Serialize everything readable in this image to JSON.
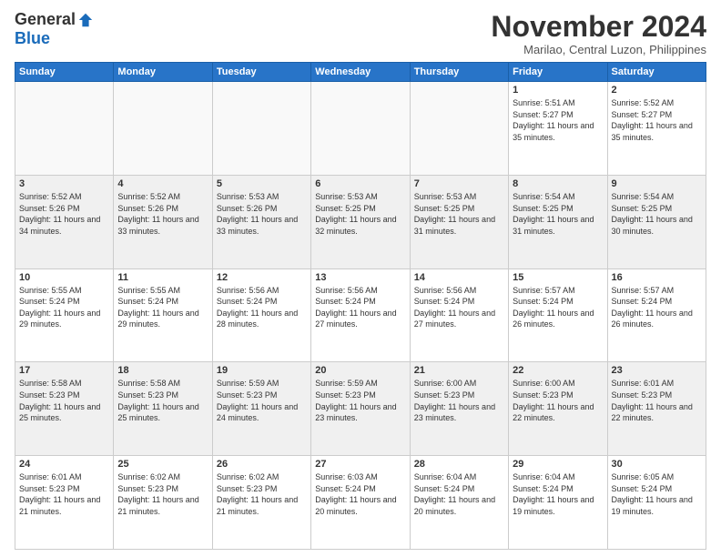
{
  "logo": {
    "general": "General",
    "blue": "Blue"
  },
  "title": "November 2024",
  "location": "Marilao, Central Luzon, Philippines",
  "weekdays": [
    "Sunday",
    "Monday",
    "Tuesday",
    "Wednesday",
    "Thursday",
    "Friday",
    "Saturday"
  ],
  "weeks": [
    [
      {
        "day": "",
        "sunrise": "",
        "sunset": "",
        "daylight": ""
      },
      {
        "day": "",
        "sunrise": "",
        "sunset": "",
        "daylight": ""
      },
      {
        "day": "",
        "sunrise": "",
        "sunset": "",
        "daylight": ""
      },
      {
        "day": "",
        "sunrise": "",
        "sunset": "",
        "daylight": ""
      },
      {
        "day": "",
        "sunrise": "",
        "sunset": "",
        "daylight": ""
      },
      {
        "day": "1",
        "sunrise": "Sunrise: 5:51 AM",
        "sunset": "Sunset: 5:27 PM",
        "daylight": "Daylight: 11 hours and 35 minutes."
      },
      {
        "day": "2",
        "sunrise": "Sunrise: 5:52 AM",
        "sunset": "Sunset: 5:27 PM",
        "daylight": "Daylight: 11 hours and 35 minutes."
      }
    ],
    [
      {
        "day": "3",
        "sunrise": "Sunrise: 5:52 AM",
        "sunset": "Sunset: 5:26 PM",
        "daylight": "Daylight: 11 hours and 34 minutes."
      },
      {
        "day": "4",
        "sunrise": "Sunrise: 5:52 AM",
        "sunset": "Sunset: 5:26 PM",
        "daylight": "Daylight: 11 hours and 33 minutes."
      },
      {
        "day": "5",
        "sunrise": "Sunrise: 5:53 AM",
        "sunset": "Sunset: 5:26 PM",
        "daylight": "Daylight: 11 hours and 33 minutes."
      },
      {
        "day": "6",
        "sunrise": "Sunrise: 5:53 AM",
        "sunset": "Sunset: 5:25 PM",
        "daylight": "Daylight: 11 hours and 32 minutes."
      },
      {
        "day": "7",
        "sunrise": "Sunrise: 5:53 AM",
        "sunset": "Sunset: 5:25 PM",
        "daylight": "Daylight: 11 hours and 31 minutes."
      },
      {
        "day": "8",
        "sunrise": "Sunrise: 5:54 AM",
        "sunset": "Sunset: 5:25 PM",
        "daylight": "Daylight: 11 hours and 31 minutes."
      },
      {
        "day": "9",
        "sunrise": "Sunrise: 5:54 AM",
        "sunset": "Sunset: 5:25 PM",
        "daylight": "Daylight: 11 hours and 30 minutes."
      }
    ],
    [
      {
        "day": "10",
        "sunrise": "Sunrise: 5:55 AM",
        "sunset": "Sunset: 5:24 PM",
        "daylight": "Daylight: 11 hours and 29 minutes."
      },
      {
        "day": "11",
        "sunrise": "Sunrise: 5:55 AM",
        "sunset": "Sunset: 5:24 PM",
        "daylight": "Daylight: 11 hours and 29 minutes."
      },
      {
        "day": "12",
        "sunrise": "Sunrise: 5:56 AM",
        "sunset": "Sunset: 5:24 PM",
        "daylight": "Daylight: 11 hours and 28 minutes."
      },
      {
        "day": "13",
        "sunrise": "Sunrise: 5:56 AM",
        "sunset": "Sunset: 5:24 PM",
        "daylight": "Daylight: 11 hours and 27 minutes."
      },
      {
        "day": "14",
        "sunrise": "Sunrise: 5:56 AM",
        "sunset": "Sunset: 5:24 PM",
        "daylight": "Daylight: 11 hours and 27 minutes."
      },
      {
        "day": "15",
        "sunrise": "Sunrise: 5:57 AM",
        "sunset": "Sunset: 5:24 PM",
        "daylight": "Daylight: 11 hours and 26 minutes."
      },
      {
        "day": "16",
        "sunrise": "Sunrise: 5:57 AM",
        "sunset": "Sunset: 5:24 PM",
        "daylight": "Daylight: 11 hours and 26 minutes."
      }
    ],
    [
      {
        "day": "17",
        "sunrise": "Sunrise: 5:58 AM",
        "sunset": "Sunset: 5:23 PM",
        "daylight": "Daylight: 11 hours and 25 minutes."
      },
      {
        "day": "18",
        "sunrise": "Sunrise: 5:58 AM",
        "sunset": "Sunset: 5:23 PM",
        "daylight": "Daylight: 11 hours and 25 minutes."
      },
      {
        "day": "19",
        "sunrise": "Sunrise: 5:59 AM",
        "sunset": "Sunset: 5:23 PM",
        "daylight": "Daylight: 11 hours and 24 minutes."
      },
      {
        "day": "20",
        "sunrise": "Sunrise: 5:59 AM",
        "sunset": "Sunset: 5:23 PM",
        "daylight": "Daylight: 11 hours and 23 minutes."
      },
      {
        "day": "21",
        "sunrise": "Sunrise: 6:00 AM",
        "sunset": "Sunset: 5:23 PM",
        "daylight": "Daylight: 11 hours and 23 minutes."
      },
      {
        "day": "22",
        "sunrise": "Sunrise: 6:00 AM",
        "sunset": "Sunset: 5:23 PM",
        "daylight": "Daylight: 11 hours and 22 minutes."
      },
      {
        "day": "23",
        "sunrise": "Sunrise: 6:01 AM",
        "sunset": "Sunset: 5:23 PM",
        "daylight": "Daylight: 11 hours and 22 minutes."
      }
    ],
    [
      {
        "day": "24",
        "sunrise": "Sunrise: 6:01 AM",
        "sunset": "Sunset: 5:23 PM",
        "daylight": "Daylight: 11 hours and 21 minutes."
      },
      {
        "day": "25",
        "sunrise": "Sunrise: 6:02 AM",
        "sunset": "Sunset: 5:23 PM",
        "daylight": "Daylight: 11 hours and 21 minutes."
      },
      {
        "day": "26",
        "sunrise": "Sunrise: 6:02 AM",
        "sunset": "Sunset: 5:23 PM",
        "daylight": "Daylight: 11 hours and 21 minutes."
      },
      {
        "day": "27",
        "sunrise": "Sunrise: 6:03 AM",
        "sunset": "Sunset: 5:24 PM",
        "daylight": "Daylight: 11 hours and 20 minutes."
      },
      {
        "day": "28",
        "sunrise": "Sunrise: 6:04 AM",
        "sunset": "Sunset: 5:24 PM",
        "daylight": "Daylight: 11 hours and 20 minutes."
      },
      {
        "day": "29",
        "sunrise": "Sunrise: 6:04 AM",
        "sunset": "Sunset: 5:24 PM",
        "daylight": "Daylight: 11 hours and 19 minutes."
      },
      {
        "day": "30",
        "sunrise": "Sunrise: 6:05 AM",
        "sunset": "Sunset: 5:24 PM",
        "daylight": "Daylight: 11 hours and 19 minutes."
      }
    ]
  ]
}
